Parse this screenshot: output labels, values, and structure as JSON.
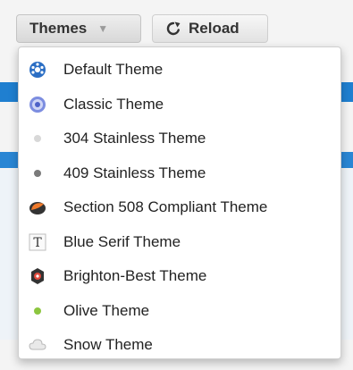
{
  "toolbar": {
    "themes_label": "Themes",
    "reload_label": "Reload"
  },
  "menu": {
    "items": [
      {
        "label": "Default Theme",
        "icon": "cog-dots-icon"
      },
      {
        "label": "Classic Theme",
        "icon": "circle-target-icon"
      },
      {
        "label": "304 Stainless Theme",
        "icon": "light-dot-icon"
      },
      {
        "label": "409 Stainless Theme",
        "icon": "dark-dot-icon"
      },
      {
        "label": "Section 508 Compliant Theme",
        "icon": "contrast-ball-icon"
      },
      {
        "label": "Blue Serif Theme",
        "icon": "serif-t-icon"
      },
      {
        "label": "Brighton-Best Theme",
        "icon": "badge-icon"
      },
      {
        "label": "Olive Theme",
        "icon": "green-dot-icon"
      },
      {
        "label": "Snow Theme",
        "icon": "cloud-icon"
      }
    ]
  },
  "colors": {
    "accent_blue": "#1f7fd0",
    "olive": "#8cc63f",
    "orange": "#f07a2a"
  }
}
